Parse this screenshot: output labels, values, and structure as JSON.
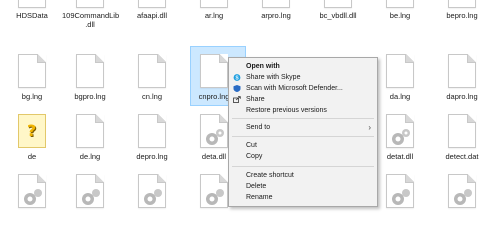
{
  "files": {
    "row1": [
      "HDSData",
      "109CommandLib\n.dll",
      "afaapi.dll",
      "ar.lng",
      "arpro.lng",
      "bc_vbdll.dll",
      "be.lng",
      "bepro.lng"
    ],
    "row2": [
      "bg.lng",
      "bgpro.lng",
      "cn.lng",
      "cnpro.lng",
      "",
      "",
      "da.lng",
      "dapro.lng"
    ],
    "row3": [
      "de",
      "de.lng",
      "depro.lng",
      "deta.dll",
      "",
      "",
      "detat.dll",
      "detect.dat"
    ]
  },
  "context_menu": {
    "open_with": "Open with",
    "share_skype": "Share with Skype",
    "scan_defender": "Scan with Microsoft Defender...",
    "share": "Share",
    "restore": "Restore previous versions",
    "send_to": "Send to",
    "cut": "Cut",
    "copy": "Copy",
    "create_shortcut": "Create shortcut",
    "delete": "Delete",
    "rename": "Rename"
  },
  "colors": {
    "selection": "#cce8ff",
    "skype": "#1e9fe0",
    "defender": "#2b6cc4"
  }
}
